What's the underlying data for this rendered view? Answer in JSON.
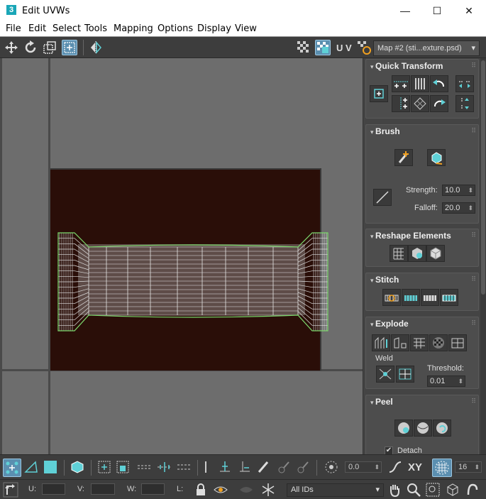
{
  "window": {
    "app_icon_text": "3",
    "title": "Edit UVWs",
    "minimize": "—",
    "maximize": "☐",
    "close": "✕"
  },
  "menu": [
    "File",
    "Edit",
    "Select",
    "Tools",
    "Mapping",
    "Options",
    "Display",
    "View"
  ],
  "toolbar": {
    "uv_label": "U V",
    "map_select": "Map #2 (sti...exture.psd)",
    "dropdown_arrow": "▾"
  },
  "panel": {
    "quick_transform": {
      "title": "Quick Transform"
    },
    "brush": {
      "title": "Brush",
      "strength_label": "Strength:",
      "strength_value": "10.0",
      "falloff_label": "Falloff:",
      "falloff_value": "20.0"
    },
    "reshape": {
      "title": "Reshape Elements"
    },
    "stitch": {
      "title": "Stitch"
    },
    "explode": {
      "title": "Explode",
      "weld_label": "Weld",
      "threshold_label": "Threshold:",
      "threshold_value": "0.01"
    },
    "peel": {
      "title": "Peel",
      "detach_label": "Detach",
      "detach_checked": "✔"
    }
  },
  "bottom": {
    "rotation_value": "0.0",
    "xy_label": "XY",
    "grid_count": "16",
    "u_label": "U:",
    "v_label": "V:",
    "w_label": "W:",
    "l_label": "L:",
    "ids_select": "All IDs"
  },
  "colors": {
    "accent": "#5fd0d6",
    "selected_bg": "#5b8fb0",
    "texture_bg": "#2a0e08",
    "uv_wire": "#7bd86b"
  }
}
